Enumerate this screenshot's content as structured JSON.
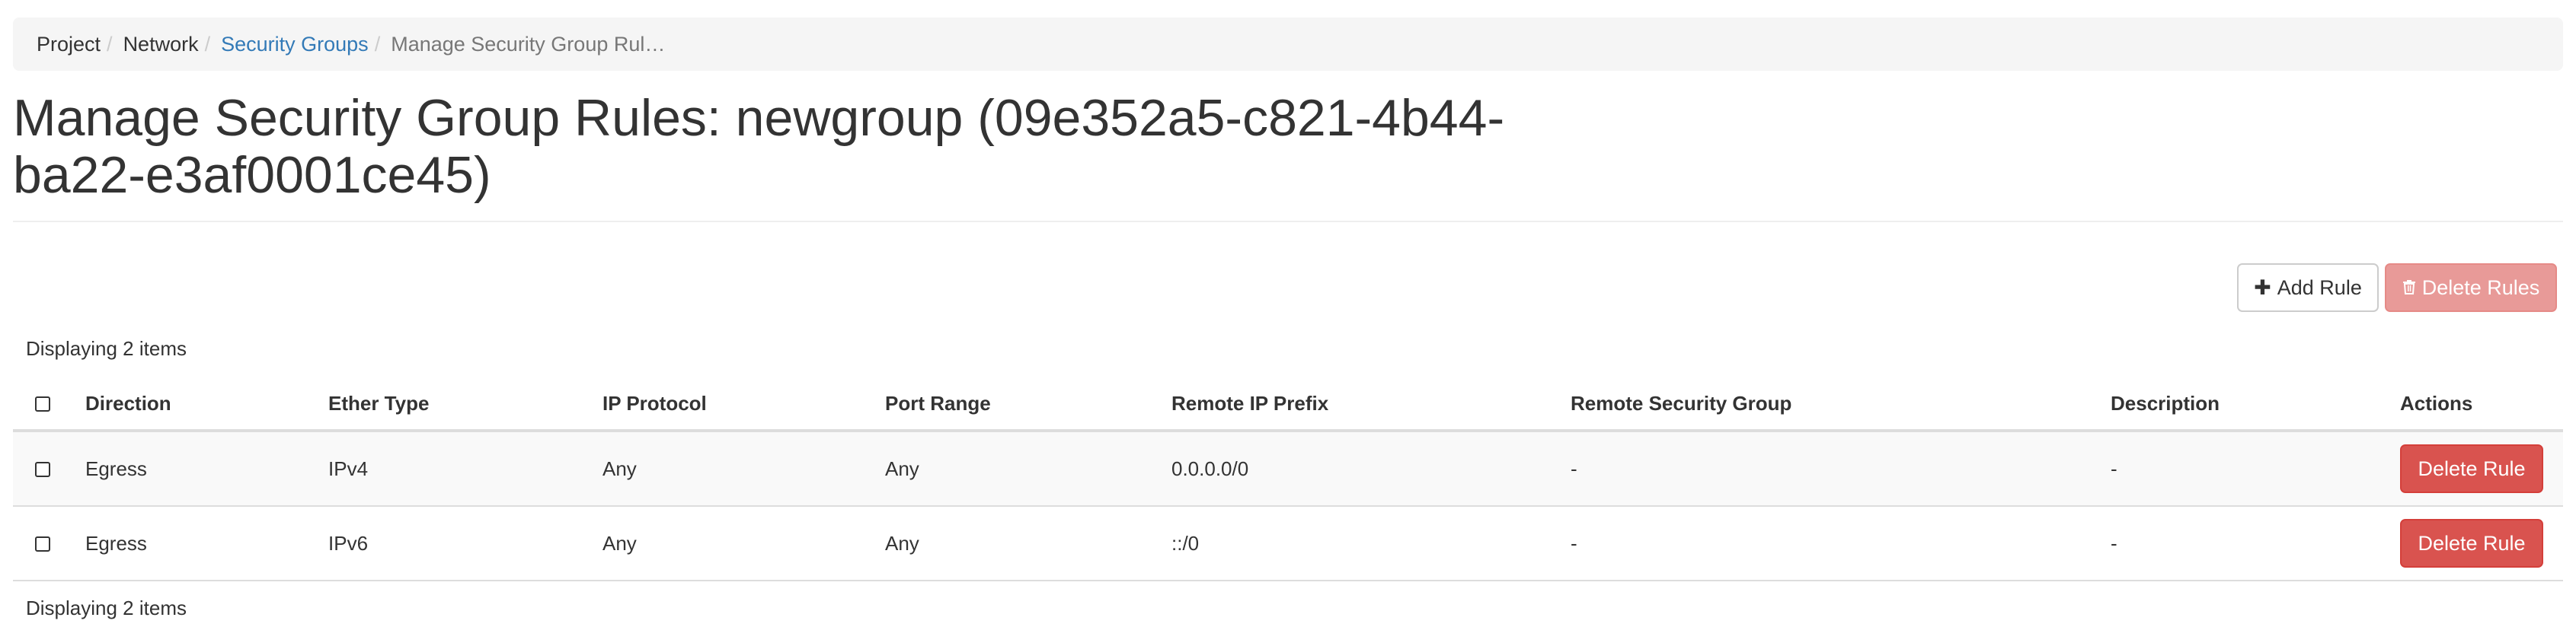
{
  "breadcrumb": {
    "items": [
      {
        "label": "Project"
      },
      {
        "label": "Network"
      },
      {
        "label": "Security Groups"
      },
      {
        "label": "Manage Security Group Rul…"
      }
    ],
    "separator": "/"
  },
  "header": {
    "title": "Manage Security Group Rules: newgroup (09e352a5-c821-4b44-ba22-e3af0001ce45)"
  },
  "toolbar": {
    "add_rule_icon": "✚",
    "add_rule_label": "Add Rule",
    "delete_rules_icon": "🗑",
    "delete_rules_label": "Delete Rules"
  },
  "table": {
    "count_top": "Displaying 2 items",
    "count_bottom": "Displaying 2 items",
    "columns": {
      "direction": "Direction",
      "ether_type": "Ether Type",
      "ip_protocol": "IP Protocol",
      "port_range": "Port Range",
      "remote_ip_prefix": "Remote IP Prefix",
      "remote_security_group": "Remote Security Group",
      "description": "Description",
      "actions": "Actions"
    },
    "rows": [
      {
        "direction": "Egress",
        "ether_type": "IPv4",
        "ip_protocol": "Any",
        "port_range": "Any",
        "remote_ip_prefix": "0.0.0.0/0",
        "remote_security_group": "-",
        "description": "-",
        "action": "Delete Rule"
      },
      {
        "direction": "Egress",
        "ether_type": "IPv6",
        "ip_protocol": "Any",
        "port_range": "Any",
        "remote_ip_prefix": "::/0",
        "remote_security_group": "-",
        "description": "-",
        "action": "Delete Rule"
      }
    ]
  },
  "colors": {
    "link": "#337ab7",
    "danger": "#d9534f",
    "danger_disabled": "#e89a98",
    "breadcrumb_bg": "#f5f5f5"
  }
}
